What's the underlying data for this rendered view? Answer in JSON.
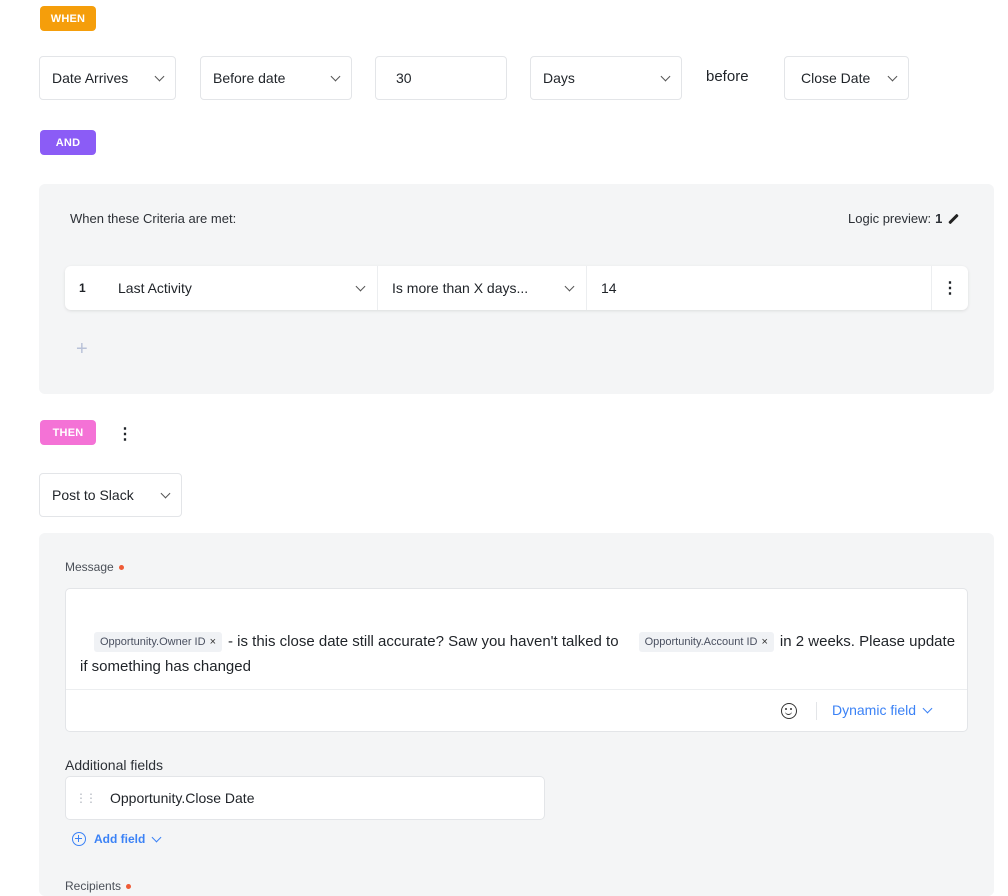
{
  "trigger": {
    "when_tag": "WHEN",
    "event": "Date Arrives",
    "timing": "Before date",
    "amount": "30",
    "unit": "Days",
    "relation": "before",
    "date_field": "Close Date"
  },
  "and_tag": "AND",
  "criteria": {
    "title": "When these Criteria are met:",
    "logic_label": "Logic preview:",
    "logic_value": "1",
    "rows": [
      {
        "num": "1",
        "field": "Last Activity",
        "operator": "Is more than X days...",
        "value": "14"
      }
    ],
    "add_symbol": "+"
  },
  "then_tag": "THEN",
  "action": {
    "type": "Post to Slack",
    "message_label": "Message",
    "message": {
      "chip1": "Opportunity.Owner ID",
      "text1": "- is this close date still accurate? Saw you haven't talked to",
      "chip2": "Opportunity.Account ID",
      "text2": "in 2 weeks. Please update if something has changed",
      "chip_remove": "×"
    },
    "dynamic_field_label": "Dynamic field",
    "additional_fields_label": "Additional fields",
    "additional_fields": [
      "Opportunity.Close Date"
    ],
    "add_field_label": "Add field",
    "recipients_label": "Recipients"
  },
  "colors": {
    "when": "#f59e0b",
    "and": "#8b5cf6",
    "then": "#f472d6",
    "link": "#3b82f6",
    "required": "#ef5b36"
  }
}
